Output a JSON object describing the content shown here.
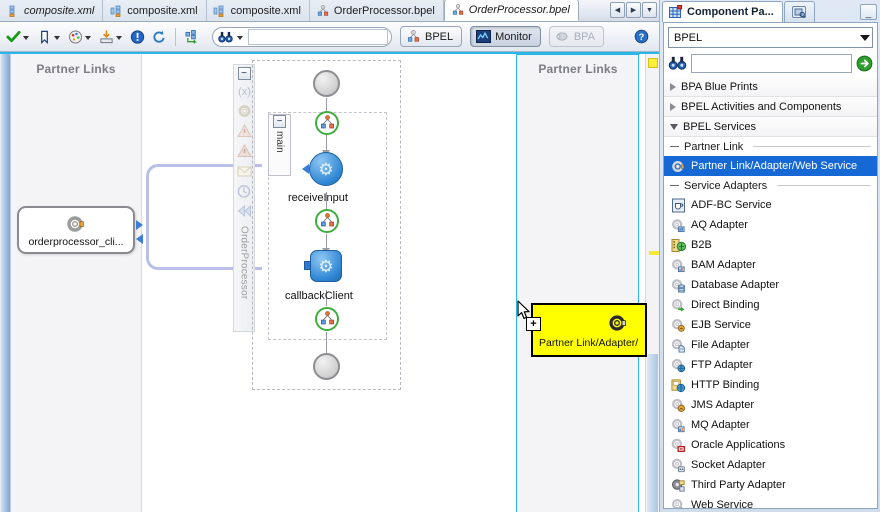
{
  "tabs": [
    {
      "label": "composite.xml",
      "icon": "composite-icon",
      "active": false,
      "italic": true
    },
    {
      "label": "composite.xml",
      "icon": "composite-icon",
      "active": false,
      "italic": false
    },
    {
      "label": "composite.xml",
      "icon": "composite-icon",
      "active": false,
      "italic": false
    },
    {
      "label": "OrderProcessor.bpel",
      "icon": "bpel-icon",
      "active": false,
      "italic": false
    },
    {
      "label": "OrderProcessor.bpel",
      "icon": "bpel-icon",
      "active": true,
      "italic": true
    }
  ],
  "tab_nav": {
    "prev": "◀",
    "next": "▶",
    "list": "▼"
  },
  "toolbar": {
    "validate_label": "✔",
    "bookmark_label": "⚑",
    "palette_label": "◉",
    "deploy_label": "☸",
    "error_label": "!",
    "refresh_label": "↻",
    "xml_label": "▤",
    "search_icon": "binoculars-icon",
    "search_value": "",
    "search_placeholder": "",
    "bpel_label": "BPEL",
    "monitor_label": "Monitor",
    "bpa_label": "BPA",
    "help_label": "?"
  },
  "editor": {
    "left_lane_title": "Partner Links",
    "right_lane_title": "Partner Links",
    "partner_link_node": {
      "label": "orderprocessor_cli...",
      "icon": "gear-icon"
    },
    "scope": {
      "main_label": "main",
      "collapse_label": "−"
    },
    "activity_strip": {
      "collapse_label": "−",
      "icons": [
        "variables-icon",
        "gear-icon",
        "catch-icon",
        "catch-all-icon",
        "mail-icon",
        "timer-icon",
        "compensate-icon"
      ],
      "vertical_label": "OrderProcessor"
    },
    "flow_nodes": [
      {
        "name": "start-event",
        "label": "",
        "type": "start"
      },
      {
        "name": "assign-1",
        "label": "",
        "type": "assign"
      },
      {
        "name": "receive-activity",
        "label": "receiveInput",
        "type": "activity"
      },
      {
        "name": "assign-2",
        "label": "",
        "type": "assign"
      },
      {
        "name": "callback-activity",
        "label": "callbackClient",
        "type": "activity-square"
      },
      {
        "name": "assign-3",
        "label": "",
        "type": "assign"
      },
      {
        "name": "end-event",
        "label": "",
        "type": "end"
      }
    ],
    "drag_ghost": {
      "label": "Partner Link/Adapter/",
      "icon": "gear-icon",
      "badge": "+",
      "color": "#ffff00"
    }
  },
  "palette": {
    "tab_label": "Component Pa...",
    "tab_icon": "palette-grid-icon",
    "tab2_icon": "resource-icon",
    "minimize_label": "_",
    "technology": "BPEL",
    "search_icon": "binoculars-icon",
    "search_value": "",
    "add_label": "➕",
    "groups": [
      {
        "label": "BPA Blue Prints",
        "state": "closed"
      },
      {
        "label": "BPEL Activities and Components",
        "state": "closed"
      },
      {
        "label": "BPEL Services",
        "state": "open"
      }
    ],
    "sections": [
      {
        "label": "Partner Link",
        "items": [
          {
            "label": "Partner Link/Adapter/Web Service",
            "icon": "gear-icon",
            "selected": true
          }
        ]
      },
      {
        "label": "Service Adapters",
        "items": [
          {
            "label": "ADF-BC Service",
            "icon": "adfbc-icon",
            "selected": false
          },
          {
            "label": "AQ Adapter",
            "icon": "aq-icon",
            "selected": false
          },
          {
            "label": "B2B",
            "icon": "b2b-icon",
            "selected": false
          },
          {
            "label": "BAM Adapter",
            "icon": "bam-icon",
            "selected": false
          },
          {
            "label": "Database Adapter",
            "icon": "db-icon",
            "selected": false
          },
          {
            "label": "Direct Binding",
            "icon": "direct-icon",
            "selected": false
          },
          {
            "label": "EJB Service",
            "icon": "ejb-icon",
            "selected": false
          },
          {
            "label": "File Adapter",
            "icon": "file-icon",
            "selected": false
          },
          {
            "label": "FTP Adapter",
            "icon": "ftp-icon",
            "selected": false
          },
          {
            "label": "HTTP Binding",
            "icon": "http-icon",
            "selected": false
          },
          {
            "label": "JMS Adapter",
            "icon": "jms-icon",
            "selected": false
          },
          {
            "label": "MQ Adapter",
            "icon": "mq-icon",
            "selected": false
          },
          {
            "label": "Oracle Applications",
            "icon": "oracle-apps-icon",
            "selected": false
          },
          {
            "label": "Socket Adapter",
            "icon": "socket-icon",
            "selected": false
          },
          {
            "label": "Third Party Adapter",
            "icon": "thirdparty-icon",
            "selected": false
          },
          {
            "label": "Web Service",
            "icon": "webservice-icon",
            "selected": false
          }
        ]
      }
    ]
  },
  "colors": {
    "accent": "#29b6e8",
    "selection": "#1668d4",
    "drag_highlight": "#ffff00",
    "link": "#b9bfe8"
  }
}
